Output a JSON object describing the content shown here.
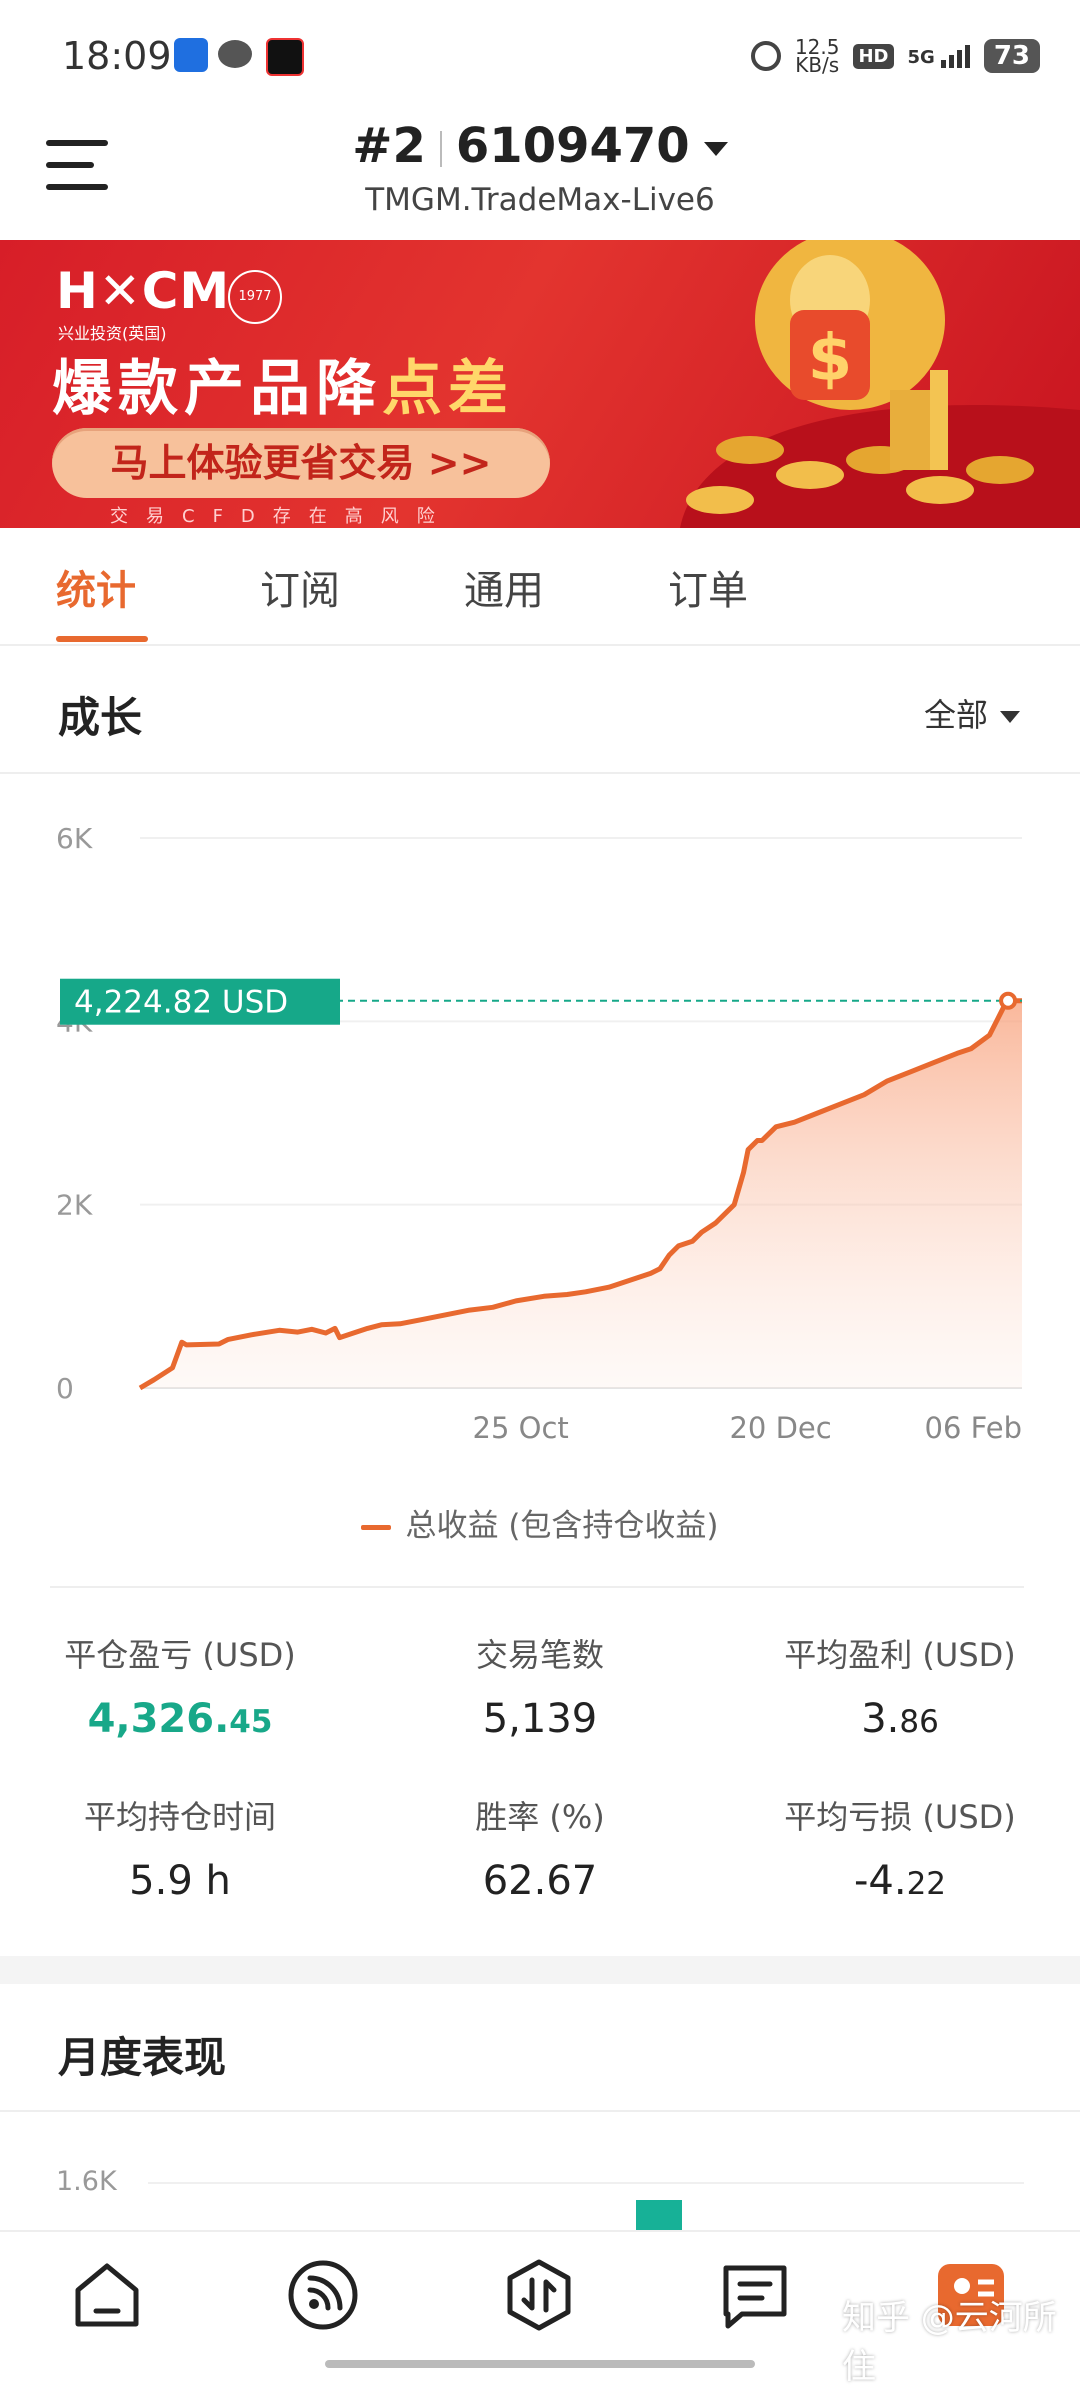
{
  "status_bar": {
    "time": "18:09",
    "net_speed": "12.5",
    "net_unit": "KB/s",
    "hd": "HD",
    "net_type": "5G",
    "battery": "73"
  },
  "header": {
    "account_index": "#2",
    "account_number": "6109470",
    "server": "TMGM.TradeMax-Live6"
  },
  "banner": {
    "logo": "H✕CM",
    "logo_sub": "兴业投资(英国)",
    "since": "1977",
    "title_prefix": "爆款产品降",
    "title_highlight": "点差",
    "cta": "马上体验更省交易 >>",
    "risk": "交易CFD存在高风险"
  },
  "tabs": [
    "统计",
    "订阅",
    "通用",
    "订单"
  ],
  "growth": {
    "title": "成长",
    "range": "全部",
    "legend": "总收益 (包含持仓收益)"
  },
  "chart_data": {
    "type": "area",
    "y_ticks": [
      "6K",
      "4K",
      "2K",
      "0"
    ],
    "ylim": [
      0,
      6000
    ],
    "x_ticks": [
      "25 Oct",
      "20 Dec",
      "06 Feb"
    ],
    "x_tick_days": [
      82,
      138,
      186
    ],
    "xlim": [
      0,
      190
    ],
    "current_value_label": "4,224.82  USD",
    "current_value": 4224.82,
    "series": [
      {
        "x": [
          0,
          3,
          7,
          9,
          10,
          17,
          19,
          24,
          30,
          34,
          37,
          40,
          42,
          43,
          46,
          49,
          52,
          56,
          61,
          66,
          71,
          76,
          81,
          87,
          92,
          96,
          101,
          104,
          107,
          110,
          112,
          114,
          116,
          119,
          121,
          124,
          128,
          130,
          131,
          133,
          134,
          137,
          141,
          146,
          151,
          156,
          161,
          166,
          171,
          176,
          179,
          183,
          185,
          186,
          187,
          188,
          190
        ],
        "y": [
          0,
          90,
          220,
          500,
          470,
          480,
          530,
          580,
          630,
          610,
          640,
          600,
          650,
          550,
          600,
          650,
          690,
          700,
          750,
          800,
          850,
          880,
          950,
          1000,
          1020,
          1050,
          1100,
          1150,
          1200,
          1250,
          1300,
          1450,
          1550,
          1600,
          1700,
          1800,
          2000,
          2350,
          2600,
          2700,
          2700,
          2850,
          2900,
          3000,
          3100,
          3200,
          3350,
          3450,
          3550,
          3650,
          3700,
          3850,
          4050,
          4150,
          4224,
          4224,
          4224
        ]
      }
    ]
  },
  "stats": [
    {
      "label": "平仓盈亏 (USD)",
      "value_main": "4,326.",
      "value_small": "45",
      "tone": "green"
    },
    {
      "label": "交易笔数",
      "value_main": "5,139",
      "value_small": "",
      "tone": "normal"
    },
    {
      "label": "平均盈利 (USD)",
      "value_main": "3.",
      "value_small": "86",
      "tone": "normal"
    },
    {
      "label": "平均持仓时间",
      "value_main": "5.9 h",
      "value_small": "",
      "tone": "normal"
    },
    {
      "label": "胜率 (%)",
      "value_main": "62.67",
      "value_small": "",
      "tone": "normal"
    },
    {
      "label": "平均亏损 (USD)",
      "value_main": "-4.",
      "value_small": "22",
      "tone": "normal"
    }
  ],
  "monthly": {
    "title": "月度表现",
    "first_tick": "1.6K"
  },
  "bottom_nav": {
    "items": [
      "home-icon",
      "signal-feed-icon",
      "trade-icon",
      "messages-icon",
      "profile-icon"
    ],
    "watermark": "知乎 @云河所住"
  },
  "colors": {
    "accent": "#e8692f",
    "green": "#18a889",
    "line": "#e8692f",
    "banner_red": "#d71e28"
  }
}
